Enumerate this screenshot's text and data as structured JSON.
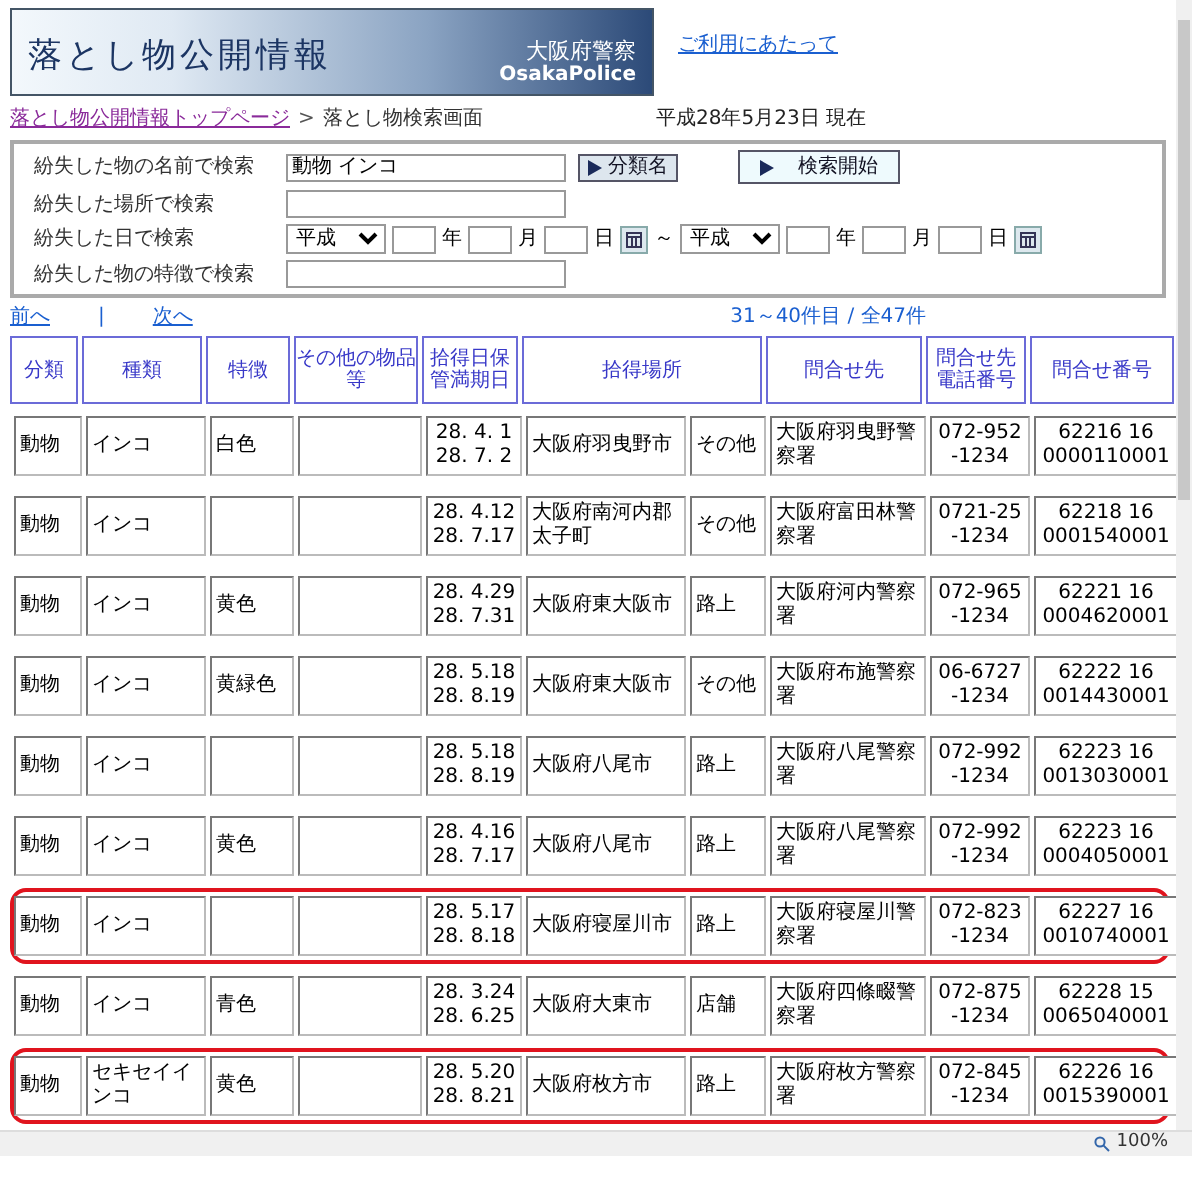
{
  "header": {
    "title": "落とし物公開情報",
    "agency": "大阪府警察",
    "agency_en": "OsakaPolice"
  },
  "top_link": "ご利用にあたって",
  "breadcrumb": {
    "link": "落とし物公開情報トップページ",
    "separator": ">",
    "current": "落とし物検索画面"
  },
  "date_note": "平成28年5月23日 現在",
  "search": {
    "name_label": "紛失した物の名前で検索",
    "name_value": "動物 インコ",
    "category_button": "分類名",
    "search_button": "検索開始",
    "place_label": "紛失した場所で検索",
    "date_label": "紛失した日で検索",
    "date_from": {
      "era": "平成",
      "year_unit": "年",
      "month_unit": "月",
      "day_unit": "日"
    },
    "range_sep": "～",
    "date_to": {
      "era": "平成",
      "year_unit": "年",
      "month_unit": "月",
      "day_unit": "日"
    },
    "feature_label": "紛失した物の特徴で検索"
  },
  "pager": {
    "prev": "前へ",
    "divider": "|",
    "next": "次へ",
    "count": "31～40件目 / 全47件"
  },
  "table": {
    "columns": [
      {
        "label": "分類",
        "kind": "single"
      },
      {
        "label": "種類",
        "kind": "single"
      },
      {
        "label": "特徴",
        "kind": "single"
      },
      {
        "label": "その他の物品等",
        "kind": "single"
      },
      {
        "label": "拾得日保管満期日",
        "kind": "single"
      },
      {
        "label": "拾得場所",
        "kind": "double"
      },
      {
        "label": "問合せ先",
        "kind": "single"
      },
      {
        "label": "問合せ先電話番号",
        "kind": "single"
      },
      {
        "label": "問合せ番号",
        "kind": "single"
      }
    ],
    "rows": [
      {
        "category": "動物",
        "type": "インコ",
        "feature": "白色",
        "found_date": "28. 4. 1",
        "deadline": "28. 7. 2",
        "place": "大阪府羽曳野市",
        "place_type": "その他",
        "contact": "大阪府羽曳野警察署",
        "phone": "072-952-1234",
        "number": "62216 16 0000110001",
        "highlighted": false
      },
      {
        "category": "動物",
        "type": "インコ",
        "found_date": "28. 4.12",
        "deadline": "28. 7.17",
        "place": "大阪府南河内郡太子町",
        "place_type": "その他",
        "contact": "大阪府富田林警察署",
        "phone": "0721-25-1234",
        "number": "62218 16 0001540001",
        "highlighted": false
      },
      {
        "category": "動物",
        "type": "インコ",
        "feature": "黄色",
        "found_date": "28. 4.29",
        "deadline": "28. 7.31",
        "place": "大阪府東大阪市",
        "place_type": "路上",
        "contact": "大阪府河内警察署",
        "phone": "072-965-1234",
        "number": "62221 16 0004620001",
        "highlighted": false
      },
      {
        "category": "動物",
        "type": "インコ",
        "feature": "黄緑色",
        "found_date": "28. 5.18",
        "deadline": "28. 8.19",
        "place": "大阪府東大阪市",
        "place_type": "その他",
        "contact": "大阪府布施警察署",
        "phone": "06-6727-1234",
        "number": "62222 16 0014430001",
        "highlighted": false
      },
      {
        "category": "動物",
        "type": "インコ",
        "found_date": "28. 5.18",
        "deadline": "28. 8.19",
        "place": "大阪府八尾市",
        "place_type": "路上",
        "contact": "大阪府八尾警察署",
        "phone": "072-992-1234",
        "number": "62223 16 0013030001",
        "highlighted": false
      },
      {
        "category": "動物",
        "type": "インコ",
        "feature": "黄色",
        "found_date": "28. 4.16",
        "deadline": "28. 7.17",
        "place": "大阪府八尾市",
        "place_type": "路上",
        "contact": "大阪府八尾警察署",
        "phone": "072-992-1234",
        "number": "62223 16 0004050001",
        "highlighted": false
      },
      {
        "category": "動物",
        "type": "インコ",
        "found_date": "28. 5.17",
        "deadline": "28. 8.18",
        "place": "大阪府寝屋川市",
        "place_type": "路上",
        "contact": "大阪府寝屋川警察署",
        "phone": "072-823-1234",
        "number": "62227 16 0010740001",
        "highlighted": true
      },
      {
        "category": "動物",
        "type": "インコ",
        "feature": "青色",
        "found_date": "28. 3.24",
        "deadline": "28. 6.25",
        "place": "大阪府大東市",
        "place_type": "店舗",
        "contact": "大阪府四條畷警察署",
        "phone": "072-875-1234",
        "number": "62228 15 0065040001",
        "highlighted": false
      },
      {
        "category": "動物",
        "type": "セキセイインコ",
        "feature": "黄色",
        "found_date": "28. 5.20",
        "deadline": "28. 8.21",
        "place": "大阪府枚方市",
        "place_type": "路上",
        "contact": "大阪府枚方警察署",
        "phone": "072-845-1234",
        "number": "62226 16 0015390001",
        "highlighted": true
      }
    ]
  },
  "status_bar": {
    "zoom": "100%"
  }
}
